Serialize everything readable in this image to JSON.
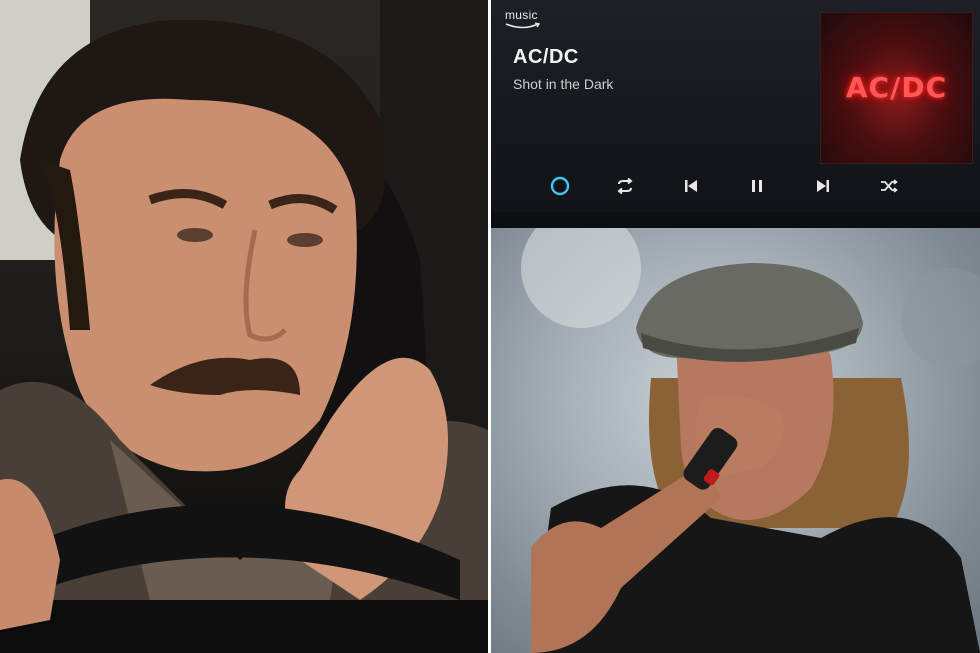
{
  "music_panel": {
    "brand": "music",
    "artist": "AC/DC",
    "track": "Shot in the Dark",
    "album_logo": "AC/DC",
    "controls": [
      "alexa-icon",
      "repeat-icon",
      "previous-icon",
      "pause-icon",
      "next-icon",
      "shuffle-icon"
    ]
  },
  "colors": {
    "panel_bg": "#15181d",
    "alexa_accent": "#3ec6f2",
    "album_neon": "#ff3b3b"
  }
}
